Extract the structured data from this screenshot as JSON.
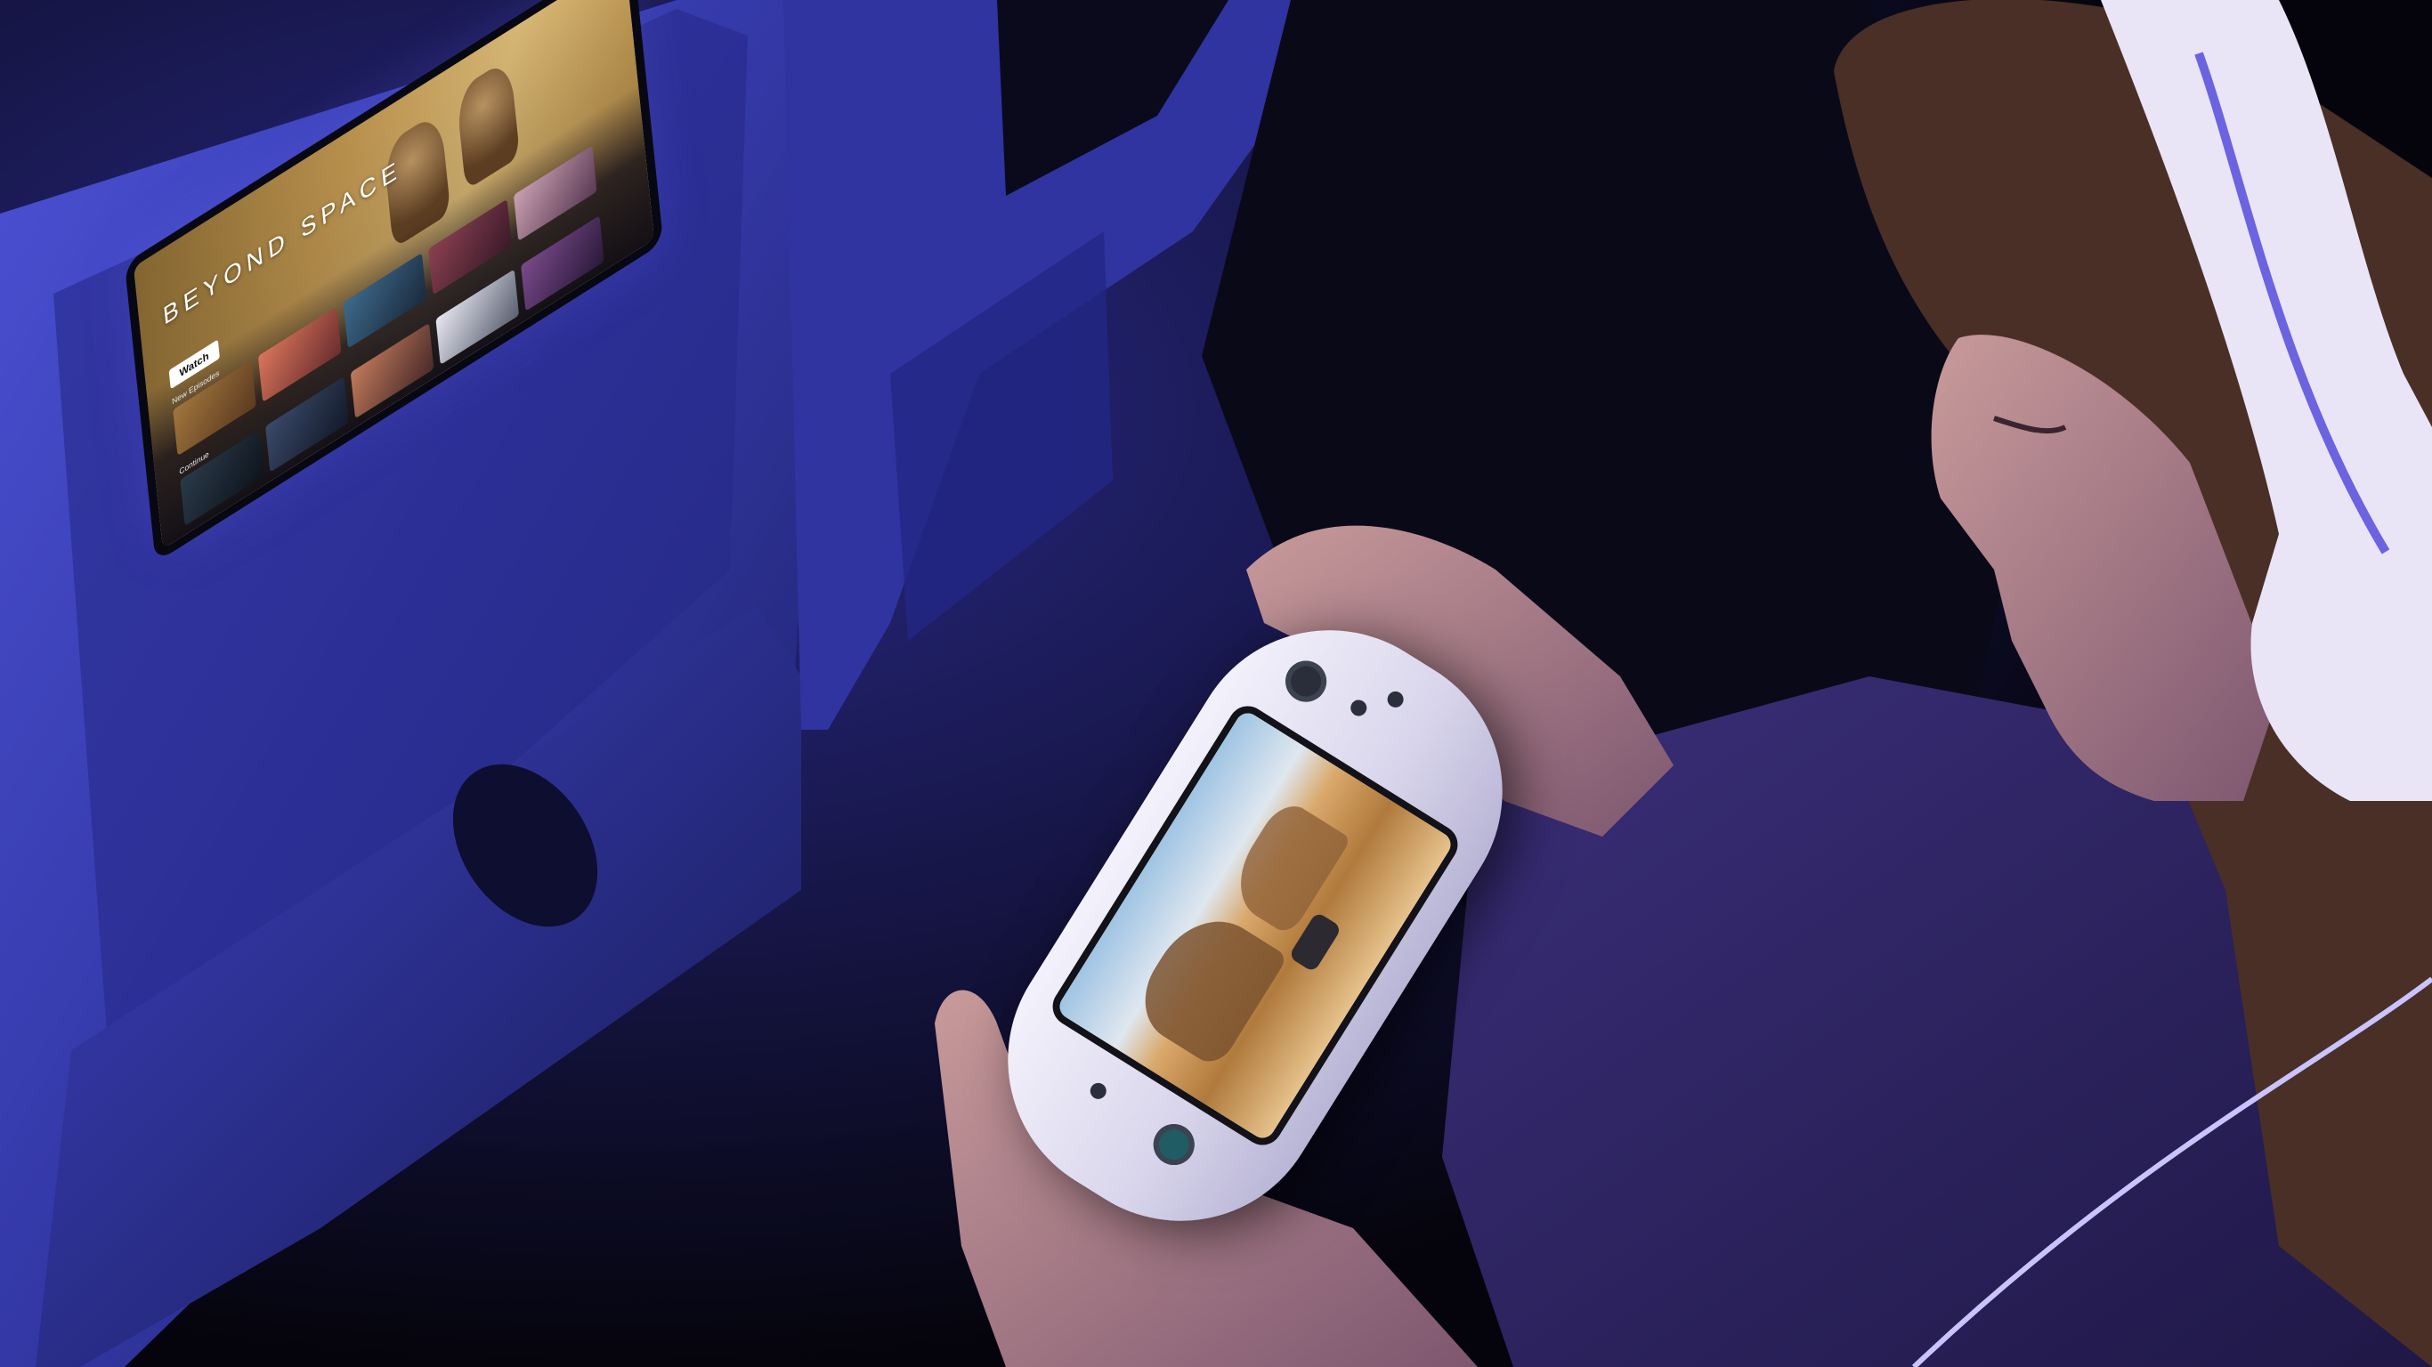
{
  "ife": {
    "title": "BEYOND SPACE",
    "watch_label": "Watch",
    "row1_label": "New Episodes",
    "row2_label": "Continue",
    "colors": {
      "hero_gold": "#c49a52",
      "screen_dark": "#0e0c14",
      "seat_blue": "#3a3fb8"
    }
  },
  "console": {
    "colors": {
      "body": "#e9e6f6",
      "stick": "#1f5c64"
    }
  },
  "scene": {
    "colors": {
      "ambient_purple": "#5b4fd6",
      "background": "#06050f",
      "headphones": "#eae6f7",
      "hair": "#5a3a2a"
    }
  }
}
